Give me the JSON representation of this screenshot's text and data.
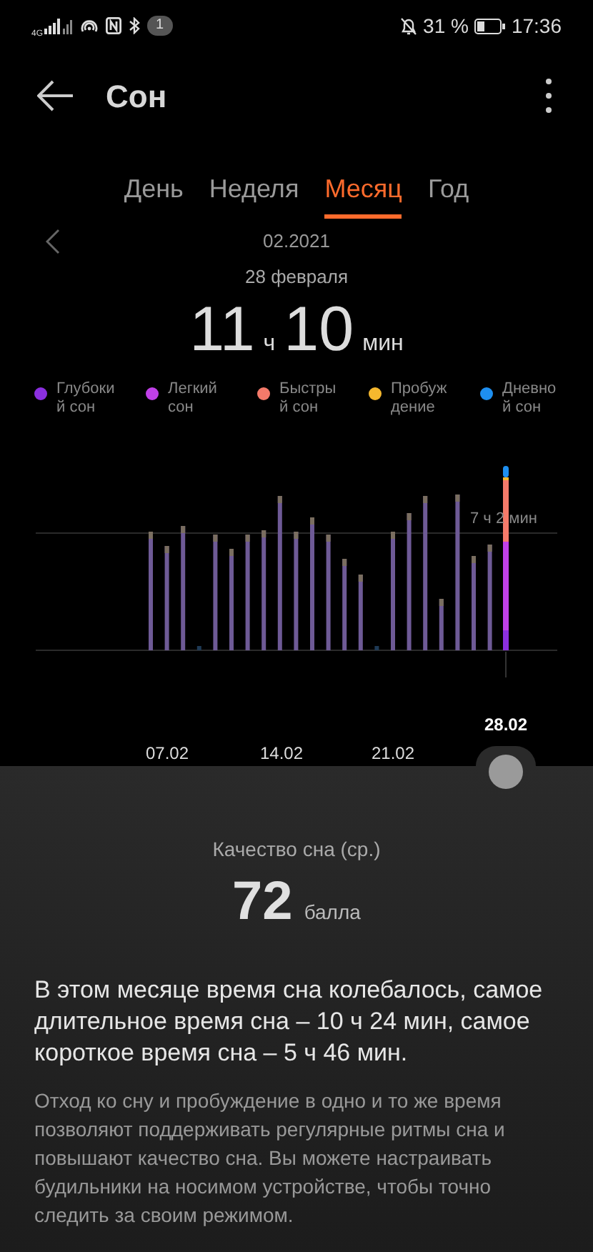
{
  "status_bar": {
    "network": "4G",
    "notification_count": "1",
    "battery": "31 %",
    "time": "17:36"
  },
  "header": {
    "title": "Сон"
  },
  "tabs": [
    {
      "label": "День",
      "selected": false
    },
    {
      "label": "Неделя",
      "selected": false
    },
    {
      "label": "Месяц",
      "selected": true
    },
    {
      "label": "Год",
      "selected": false
    }
  ],
  "period": "02.2021",
  "selected_date": "28 февраля",
  "duration": {
    "hours": "11",
    "hours_unit": "ч",
    "minutes": "10",
    "minutes_unit": "мин"
  },
  "legend": [
    {
      "label": "Глубоки\nй сон",
      "color": "#8b2fe0"
    },
    {
      "label": "Легкий\nсон",
      "color": "#c040e8"
    },
    {
      "label": "Быстры\nй сон",
      "color": "#f57a6a"
    },
    {
      "label": "Пробуж\nдение",
      "color": "#f5b82e"
    },
    {
      "label": "Дневно\nй сон",
      "color": "#1e8ff0"
    }
  ],
  "chart": {
    "average_label": "7 ч 2 мин",
    "x_labels": [
      {
        "label": "07.02",
        "selected": false
      },
      {
        "label": "14.02",
        "selected": false
      },
      {
        "label": "21.02",
        "selected": false
      },
      {
        "label": "28.02",
        "selected": true
      }
    ]
  },
  "quality": {
    "label": "Качество сна (ср.)",
    "value": "72",
    "unit": "балла"
  },
  "summary": "В этом месяце время сна колебалось, самое длительное время сна – 10 ч 24 мин, самое короткое время сна – 5 ч 46 мин.",
  "advice": "Отход ко сну и пробуждение в одно и то же время позволяют поддерживать регулярные ритмы сна и повышают качество сна. Вы можете настраивать будильники на носимом устройстве, чтобы точно следить за своим режимом."
}
